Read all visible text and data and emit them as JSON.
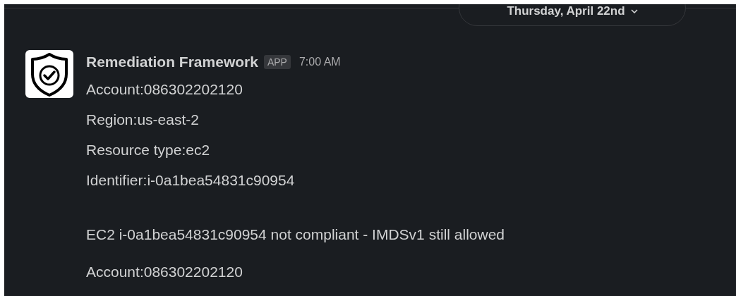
{
  "date_divider": {
    "label": "Thursday, April 22nd"
  },
  "message": {
    "sender": "Remediation Framework",
    "badge": "APP",
    "time": "7:00 AM",
    "lines": [
      "Account:086302202120",
      "Region:us-east-2",
      "Resource type:ec2",
      "Identifier:i-0a1bea54831c90954"
    ],
    "summary": "EC2 i-0a1bea54831c90954 not compliant - IMDSv1 still allowed",
    "next_line": "Account:086302202120"
  }
}
